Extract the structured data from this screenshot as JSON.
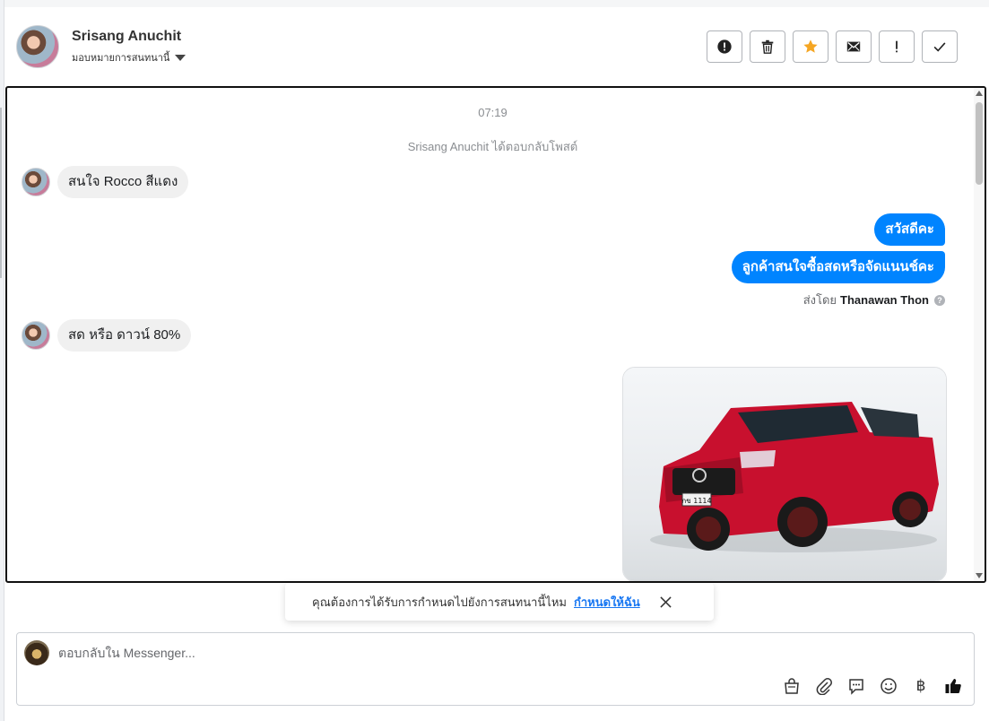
{
  "header": {
    "contact_name": "Srisang Anuchit",
    "assign_label": "มอบหมายการสนทนานี้"
  },
  "toolbar": {
    "buttons": [
      "spam-report",
      "delete",
      "star",
      "mark-unread",
      "important",
      "done"
    ],
    "star_color": "#f5a623"
  },
  "chat": {
    "timestamp": "07:19",
    "system_note": "Srisang Anuchit ได้ตอบกลับโพสต์",
    "messages": [
      {
        "direction": "in",
        "text": "สนใจ Rocco สีแดง"
      },
      {
        "direction": "out",
        "text": "สวัสดีคะ"
      },
      {
        "direction": "out",
        "text": "ลูกค้าสนใจซื้อสดหรือจัดแนนช์คะ"
      },
      {
        "direction": "in",
        "text": "สด หรือ ดาวน์ 80%"
      }
    ],
    "sent_by_prefix": "ส่งโดย",
    "sent_by_name": "Thanawan Thon",
    "help_symbol": "?",
    "car_plate": "กข 1114"
  },
  "toast": {
    "text": "คุณต้องการได้รับการกำหนดไปยังการสนทนานี้ไหม",
    "link": "กำหนดให้ฉัน"
  },
  "composer": {
    "placeholder": "ตอบกลับใน Messenger...",
    "currency_symbol": "฿"
  },
  "colors": {
    "outgoing_bubble": "#0084ff",
    "incoming_bubble": "#f0f0f0",
    "link": "#1877f2"
  }
}
